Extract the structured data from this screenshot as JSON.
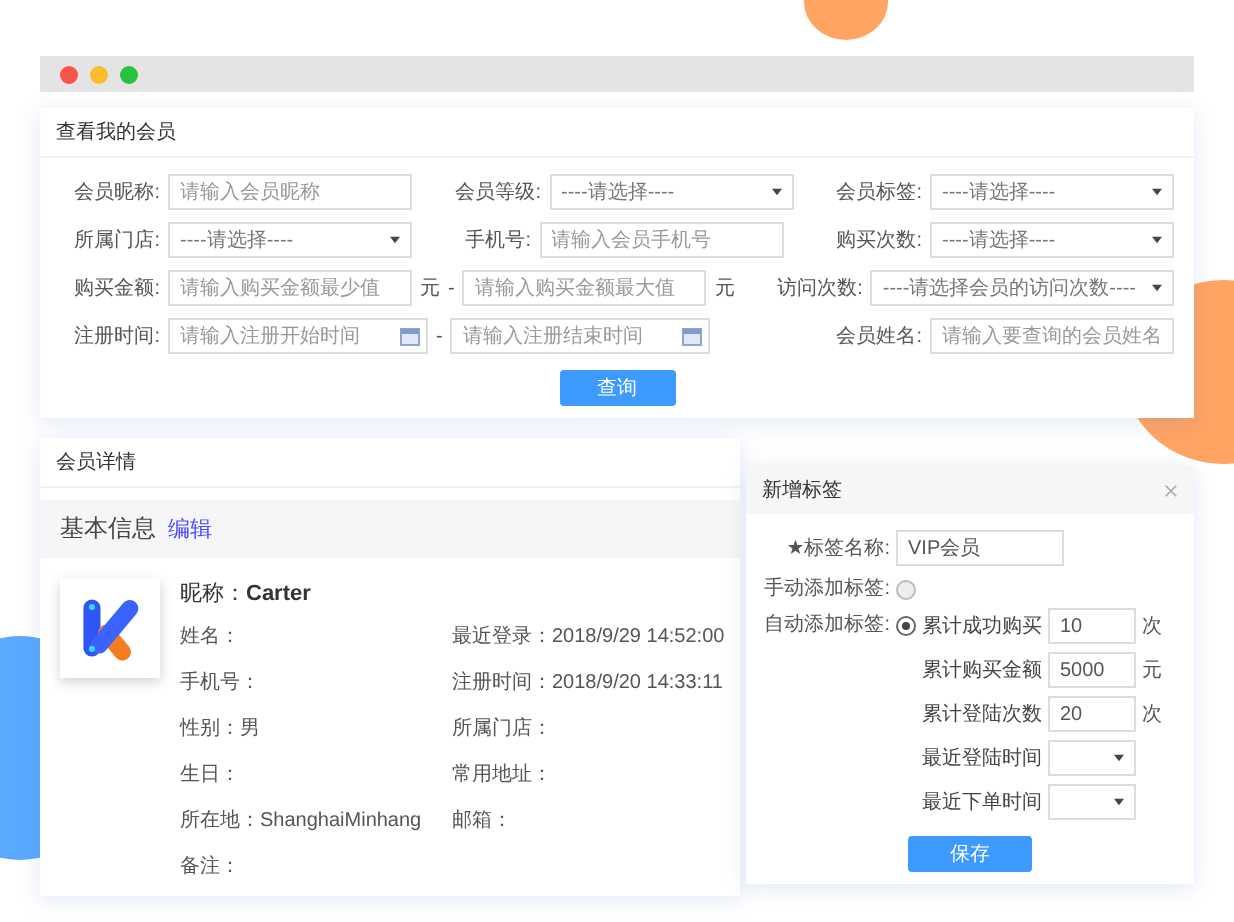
{
  "member_search": {
    "title": "查看我的会员",
    "rows": [
      [
        [
          {
            "kind": "label",
            "text": "会员昵称:"
          },
          {
            "kind": "input",
            "placeholder": "请输入会员昵称"
          }
        ],
        [
          {
            "kind": "label",
            "text": "会员等级:"
          },
          {
            "kind": "select",
            "placeholder": "----请选择----"
          }
        ],
        [
          {
            "kind": "label",
            "text": "会员标签:"
          },
          {
            "kind": "select",
            "placeholder": "----请选择----"
          }
        ]
      ],
      [
        [
          {
            "kind": "label",
            "text": "所属门店:"
          },
          {
            "kind": "select",
            "placeholder": "----请选择----"
          }
        ],
        [
          {
            "kind": "label",
            "text": "手机号:"
          },
          {
            "kind": "input",
            "placeholder": "请输入会员手机号"
          }
        ],
        [
          {
            "kind": "label",
            "text": "购买次数:"
          },
          {
            "kind": "select",
            "placeholder": "----请选择----"
          }
        ]
      ],
      [
        [
          {
            "kind": "label",
            "text": "购买金额:"
          },
          {
            "kind": "input",
            "placeholder": "请输入购买金额最少值"
          },
          {
            "kind": "text",
            "text": "元"
          },
          {
            "kind": "text",
            "text": "-"
          },
          {
            "kind": "input",
            "placeholder": "请输入购买金额最大值"
          },
          {
            "kind": "text",
            "text": "元"
          }
        ],
        [
          {
            "kind": "label",
            "text": "访问次数:"
          },
          {
            "kind": "select",
            "placeholder": "----请选择会员的访问次数----"
          }
        ]
      ],
      [
        [
          {
            "kind": "label",
            "text": "注册时间:"
          },
          {
            "kind": "date",
            "placeholder": "请输入注册开始时间"
          },
          {
            "kind": "text",
            "text": "-"
          },
          {
            "kind": "date",
            "placeholder": "请输入注册结束时间"
          }
        ],
        [
          {
            "kind": "label",
            "text": "会员姓名:"
          },
          {
            "kind": "input",
            "placeholder": "请输入要查询的会员姓名"
          }
        ]
      ]
    ],
    "button": "查询"
  },
  "member_detail": {
    "title": "会员详情",
    "section_title": "基本信息",
    "edit_link": "编辑",
    "nickname": {
      "label": "昵称：",
      "value": "Carter"
    },
    "fields": [
      {
        "label": "姓名："
      },
      {
        "label": "最近登录：",
        "value": "2018/9/29 14:52:00"
      },
      {
        "label": "手机号："
      },
      {
        "label": "注册时间：",
        "value": "2018/9/20 14:33:11"
      },
      {
        "label": "性别：",
        "value": "男"
      },
      {
        "label": "所属门店："
      },
      {
        "label": "生日："
      },
      {
        "label": "常用地址："
      },
      {
        "label": "所在地：",
        "value": "ShanghaiMinhang"
      },
      {
        "label": "邮箱："
      },
      {
        "label": "备注："
      }
    ]
  },
  "add_tag_dialog": {
    "title": "新增标签",
    "name_field": {
      "label": "★标签名称:",
      "value": "VIP会员"
    },
    "modes": [
      {
        "label": "手动添加标签:",
        "selected": false
      },
      {
        "label": "自动添加标签:",
        "selected": true
      }
    ],
    "conditions": [
      {
        "label": "累计成功购买",
        "kind": "input",
        "value": "10",
        "unit": "次"
      },
      {
        "label": "累计购买金额",
        "kind": "input",
        "value": "5000",
        "unit": "元"
      },
      {
        "label": "累计登陆次数",
        "kind": "input",
        "value": "20",
        "unit": "次"
      },
      {
        "label": "最近登陆时间",
        "kind": "select"
      },
      {
        "label": "最近下单时间",
        "kind": "select"
      }
    ],
    "button": "保存"
  }
}
